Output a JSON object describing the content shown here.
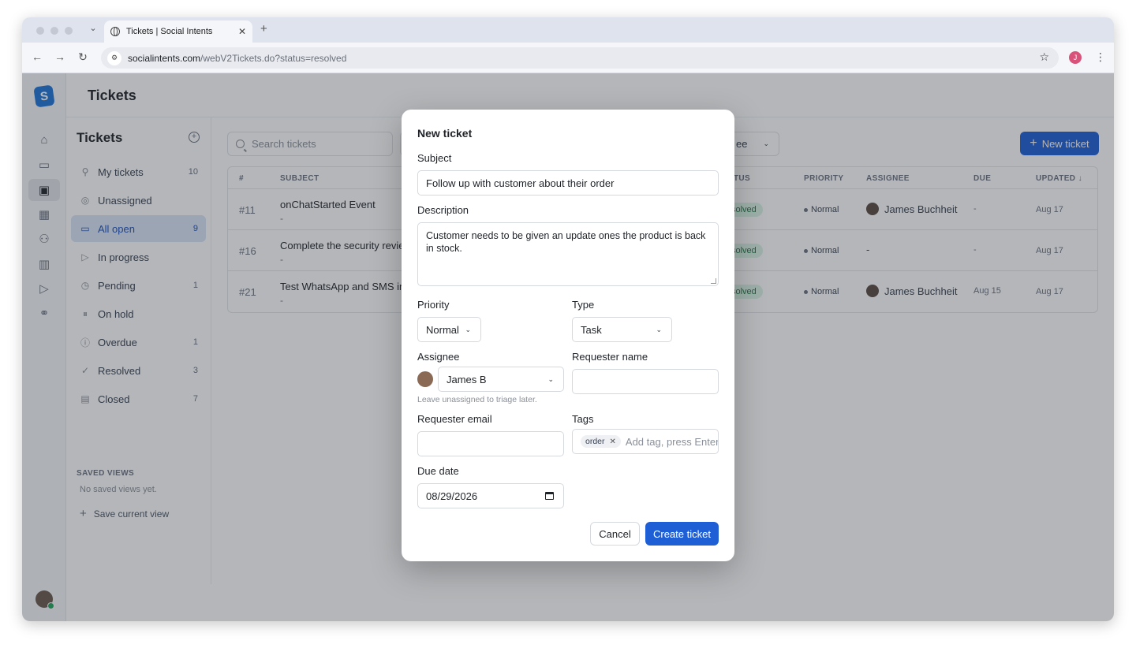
{
  "browser": {
    "tab_title": "Tickets | Social Intents",
    "url_host": "socialintents.com",
    "url_path": "/webV2Tickets.do?status=resolved",
    "profile_initial": "J"
  },
  "app": {
    "page_title": "Tickets",
    "sidebar": {
      "title": "Tickets",
      "items": [
        {
          "label": "My tickets",
          "count": "10",
          "icon": "user-icon"
        },
        {
          "label": "Unassigned",
          "count": "",
          "icon": "user-circle-icon"
        },
        {
          "label": "All open",
          "count": "9",
          "icon": "inbox-icon"
        },
        {
          "label": "In progress",
          "count": "",
          "icon": "play-icon"
        },
        {
          "label": "Pending",
          "count": "1",
          "icon": "clock-icon"
        },
        {
          "label": "On hold",
          "count": "",
          "icon": "pause-icon"
        },
        {
          "label": "Overdue",
          "count": "1",
          "icon": "alert-icon"
        },
        {
          "label": "Resolved",
          "count": "3",
          "icon": "check-circle-icon"
        },
        {
          "label": "Closed",
          "count": "7",
          "icon": "archive-icon"
        }
      ],
      "saved_views_heading": "SAVED VIEWS",
      "saved_views_empty": "No saved views yet.",
      "save_current_view": "Save current view"
    },
    "search_placeholder": "Search tickets",
    "assignee_filter_partial": "ee",
    "new_ticket_button": "New ticket",
    "table": {
      "headers": [
        "#",
        "SUBJECT",
        "ATUS",
        "PRIORITY",
        "ASSIGNEE",
        "DUE",
        "UPDATED ↓"
      ],
      "rows": [
        {
          "id": "#11",
          "subject": "onChatStarted Event",
          "sub": "-",
          "status": "solved",
          "priority": "Normal",
          "assignee": "James Buchheit",
          "due": "-",
          "updated": "Aug 17"
        },
        {
          "id": "#16",
          "subject": "Complete the security review",
          "sub": "-",
          "status": "solved",
          "priority": "Normal",
          "assignee": "-",
          "due": "-",
          "updated": "Aug 17"
        },
        {
          "id": "#21",
          "subject": "Test WhatsApp and SMS inb",
          "sub": "-",
          "status": "solved",
          "priority": "Normal",
          "assignee": "James Buchheit",
          "due": "Aug 15",
          "updated": "Aug 17"
        }
      ]
    }
  },
  "modal": {
    "title": "New ticket",
    "subject_label": "Subject",
    "subject_value": "Follow up with customer about their order",
    "description_label": "Description",
    "description_value": "Customer needs to be given an update ones the product is back in stock.",
    "priority_label": "Priority",
    "priority_value": "Normal",
    "type_label": "Type",
    "type_value": "Task",
    "assignee_label": "Assignee",
    "assignee_value": "James B",
    "assignee_hint": "Leave unassigned to triage later.",
    "requester_name_label": "Requester name",
    "requester_name_value": "",
    "requester_email_label": "Requester email",
    "requester_email_value": "",
    "tags_label": "Tags",
    "tags": [
      "order"
    ],
    "tags_placeholder": "Add tag, press Enter",
    "due_date_label": "Due date",
    "due_date_value": "08/29/2026",
    "cancel_button": "Cancel",
    "create_button": "Create ticket"
  },
  "colors": {
    "primary": "#1e5fd6",
    "active_nav_bg": "#dbe5f7",
    "status_resolved_bg": "#dcf5e6",
    "status_resolved_fg": "#1c7a44"
  }
}
